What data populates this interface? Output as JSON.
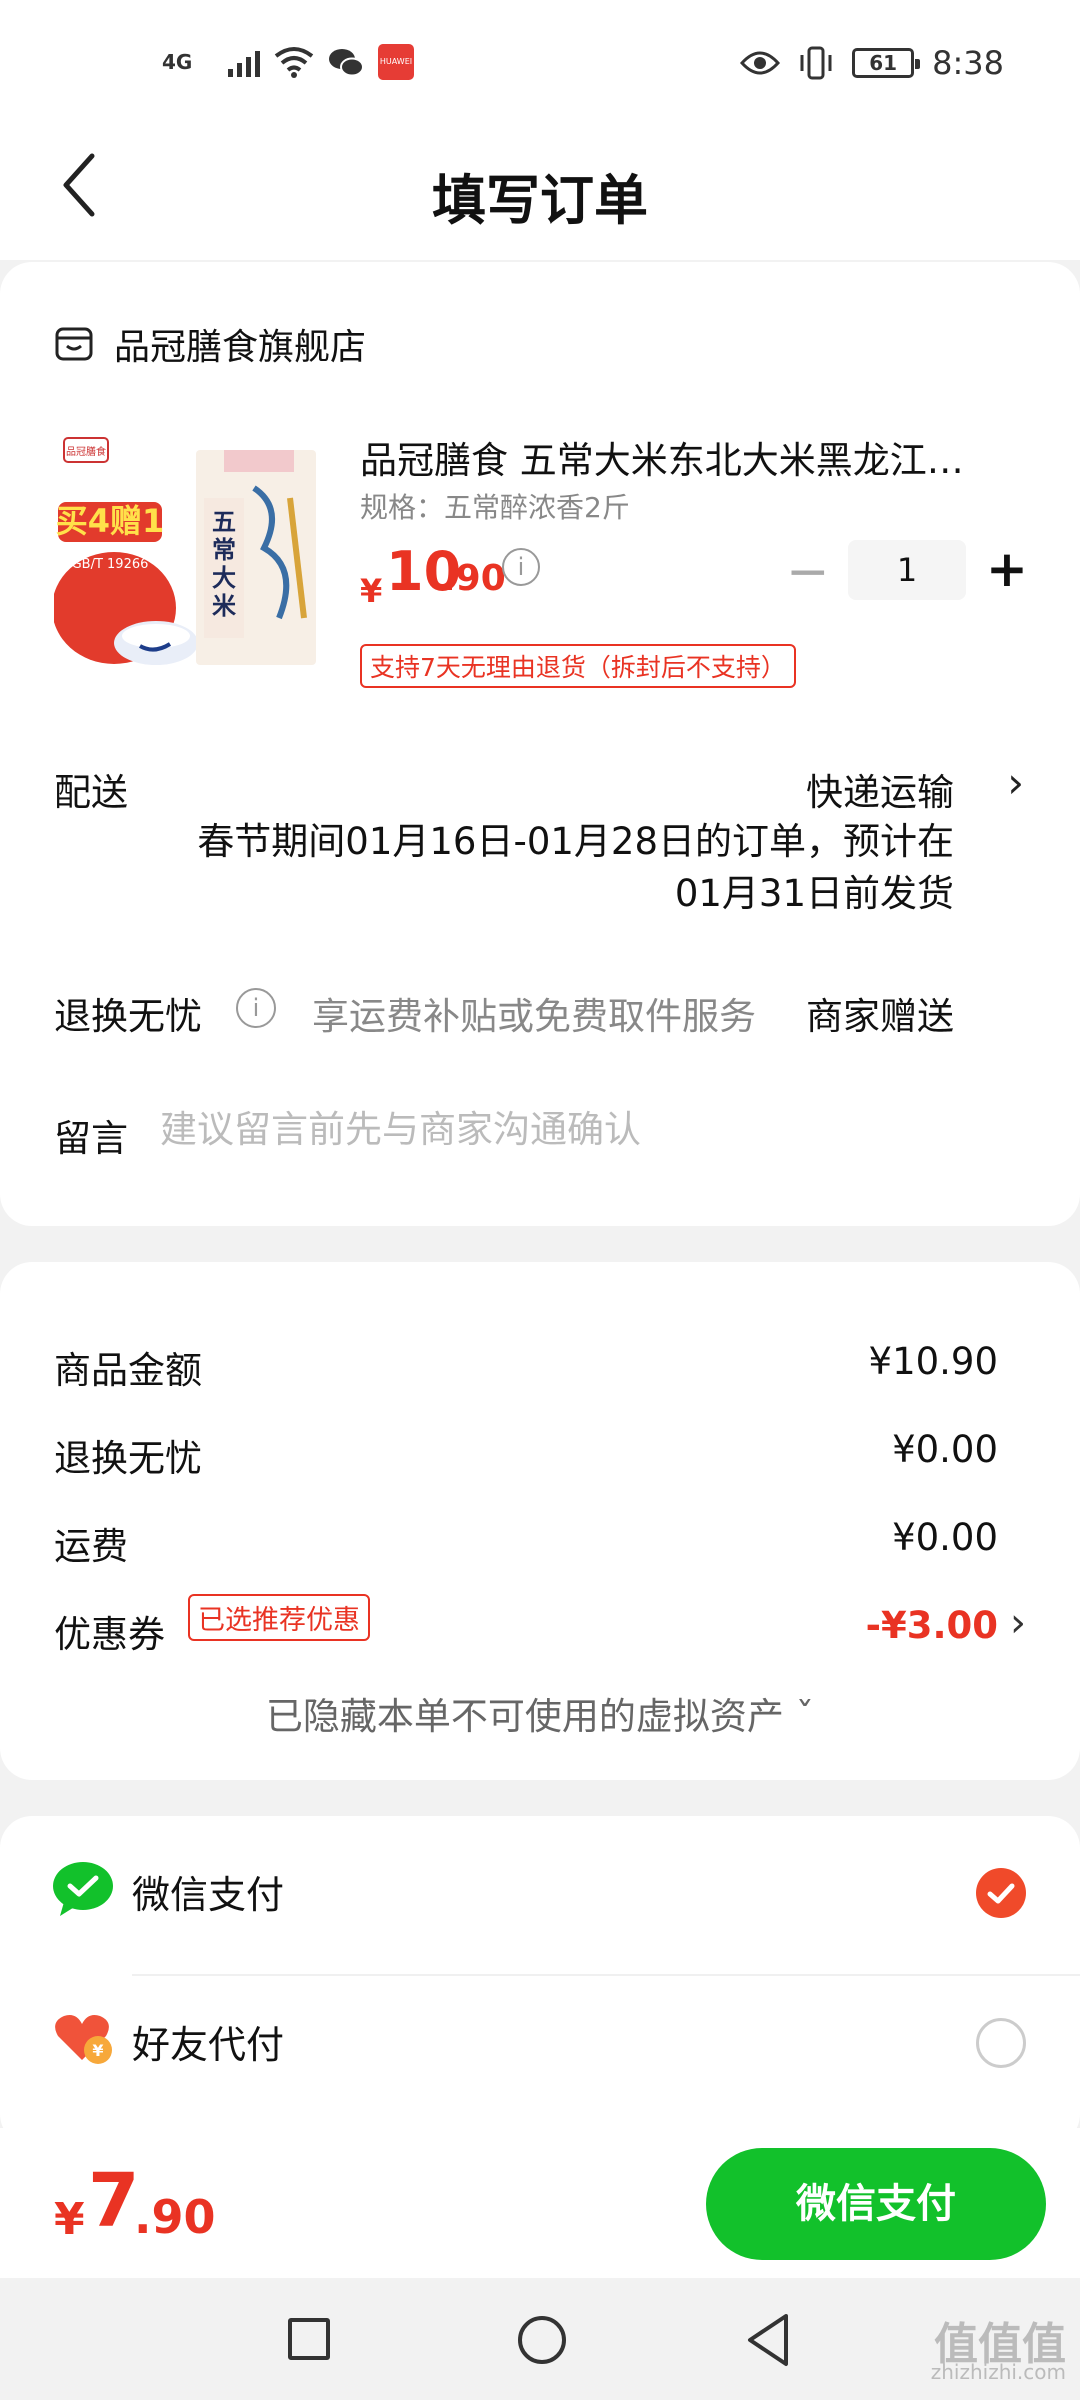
{
  "status_bar": {
    "network": "4G",
    "time": "8:38",
    "battery": "61",
    "huawei_label": "HUAWEI"
  },
  "nav": {
    "title": "填写订单"
  },
  "shop": {
    "name": "品冠膳食旗舰店"
  },
  "product": {
    "title": "品冠膳食 五常大米东北大米黑龙江…",
    "spec": "规格：五常醉浓香2斤",
    "price_currency": "¥",
    "price_int": "10",
    "price_dec": ".90",
    "quantity": "1",
    "minus": "−",
    "plus": "+",
    "return_tag": "支持7天无理由退货（拆封后不支持）",
    "image_text": {
      "promo": "买4赠1",
      "gb": "GB/T 19266",
      "brand_badge": "品冠膳食",
      "pack": "五常大米"
    }
  },
  "delivery": {
    "label": "配送",
    "value": "快递运输",
    "note": "春节期间01月16日-01月28日的订单，预计在01月31日前发货"
  },
  "return_worry": {
    "label": "退换无忧",
    "desc": "享运费补贴或免费取件服务",
    "value": "商家赠送"
  },
  "message": {
    "label": "留言",
    "placeholder": "建议留言前先与商家沟通确认"
  },
  "summary": {
    "items": [
      {
        "label": "商品金额",
        "value": "¥10.90"
      },
      {
        "label": "退换无忧",
        "value": "¥0.00"
      },
      {
        "label": "运费",
        "value": "¥0.00"
      }
    ],
    "coupon": {
      "label": "优惠券",
      "tag": "已选推荐优惠",
      "value": "-¥3.00"
    },
    "hidden_assets": "已隐藏本单不可使用的虚拟资产 ˇ"
  },
  "payment": {
    "options": [
      {
        "label": "微信支付",
        "selected": true
      },
      {
        "label": "好友代付",
        "selected": false
      }
    ]
  },
  "bottom": {
    "currency": "¥",
    "total_int": "7",
    "total_dec": ".90",
    "pay_button": "微信支付"
  },
  "watermark": {
    "main": "值值值",
    "sub": "zhizhizhi.com"
  },
  "colors": {
    "accent_red": "#e93323",
    "pay_green": "#12c12b",
    "check_orange": "#f04a2a"
  }
}
